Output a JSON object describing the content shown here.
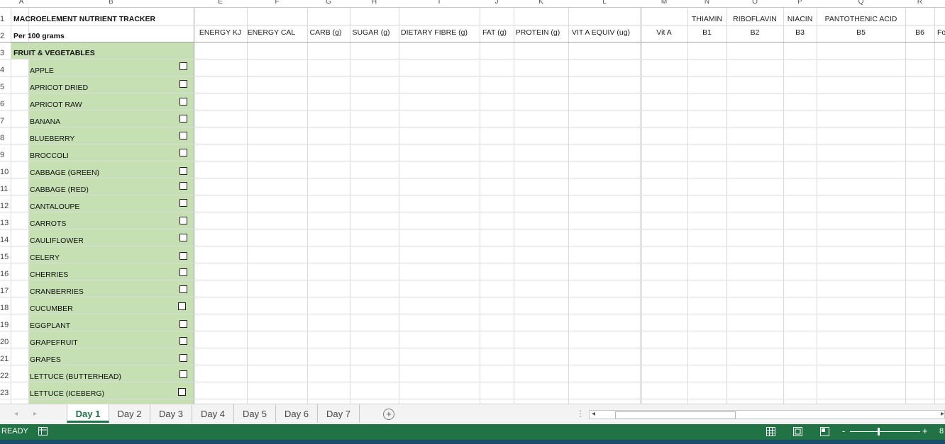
{
  "columns": {
    "letters": [
      "A",
      "B",
      "E",
      "F",
      "G",
      "H",
      "I",
      "J",
      "K",
      "L",
      "M",
      "N",
      "O",
      "P",
      "Q",
      "R"
    ]
  },
  "row_numbers": [
    "1",
    "2",
    "3",
    "4",
    "5",
    "6",
    "7",
    "8",
    "9",
    "10",
    "11",
    "12",
    "13",
    "14",
    "15",
    "16",
    "17",
    "18",
    "19",
    "20",
    "21",
    "22",
    "23"
  ],
  "sheet": {
    "title": "MACROELEMENT NUTRIENT TRACKER",
    "subtitle": "Per 100 grams",
    "category": "FRUIT & VEGETABLES",
    "foods": [
      "APPLE",
      "APRICOT DRIED",
      "APRICOT RAW",
      "BANANA",
      "BLUEBERRY",
      "BROCCOLI",
      "CABBAGE (GREEN)",
      "CABBAGE (RED)",
      "CANTALOUPE",
      "CARROTS",
      "CAULIFLOWER",
      "CELERY",
      "CHERRIES",
      "CRANBERRIES",
      "CUCUMBER",
      "EGGPLANT",
      "GRAPEFRUIT",
      "GRAPES",
      "LETTUCE (BUTTERHEAD)",
      "LETTUCE (ICEBERG)"
    ],
    "row1_headers": [
      "THIAMIN",
      "RIBOFLAVIN",
      "NIACIN",
      "PANTOTHENIC ACID"
    ],
    "row2_headers": [
      "ENERGY KJ",
      "ENERGY CAL",
      "CARB (g)",
      "SUGAR (g)",
      "DIETARY FIBRE (g)",
      "FAT (g)",
      "PROTEIN (g)",
      "VIT A EQUIV (ug)",
      "Vit A",
      "B1",
      "B2",
      "B3",
      "B5",
      "B6",
      "Fo"
    ]
  },
  "tabs": {
    "nav_prev": "◂",
    "nav_next": "▸",
    "items": [
      "Day 1",
      "Day 2",
      "Day 3",
      "Day 4",
      "Day 5",
      "Day 6",
      "Day 7"
    ],
    "active": "Day 1",
    "add": "+"
  },
  "scroll": {
    "menu": "⋮",
    "left": "◂",
    "right": "▸"
  },
  "status": {
    "mode": "READY",
    "zoom_minus": "-",
    "zoom_plus": "+",
    "zoom_level": "8"
  },
  "colors": {
    "accent": "#217346",
    "highlight": "#c6e0b4"
  }
}
